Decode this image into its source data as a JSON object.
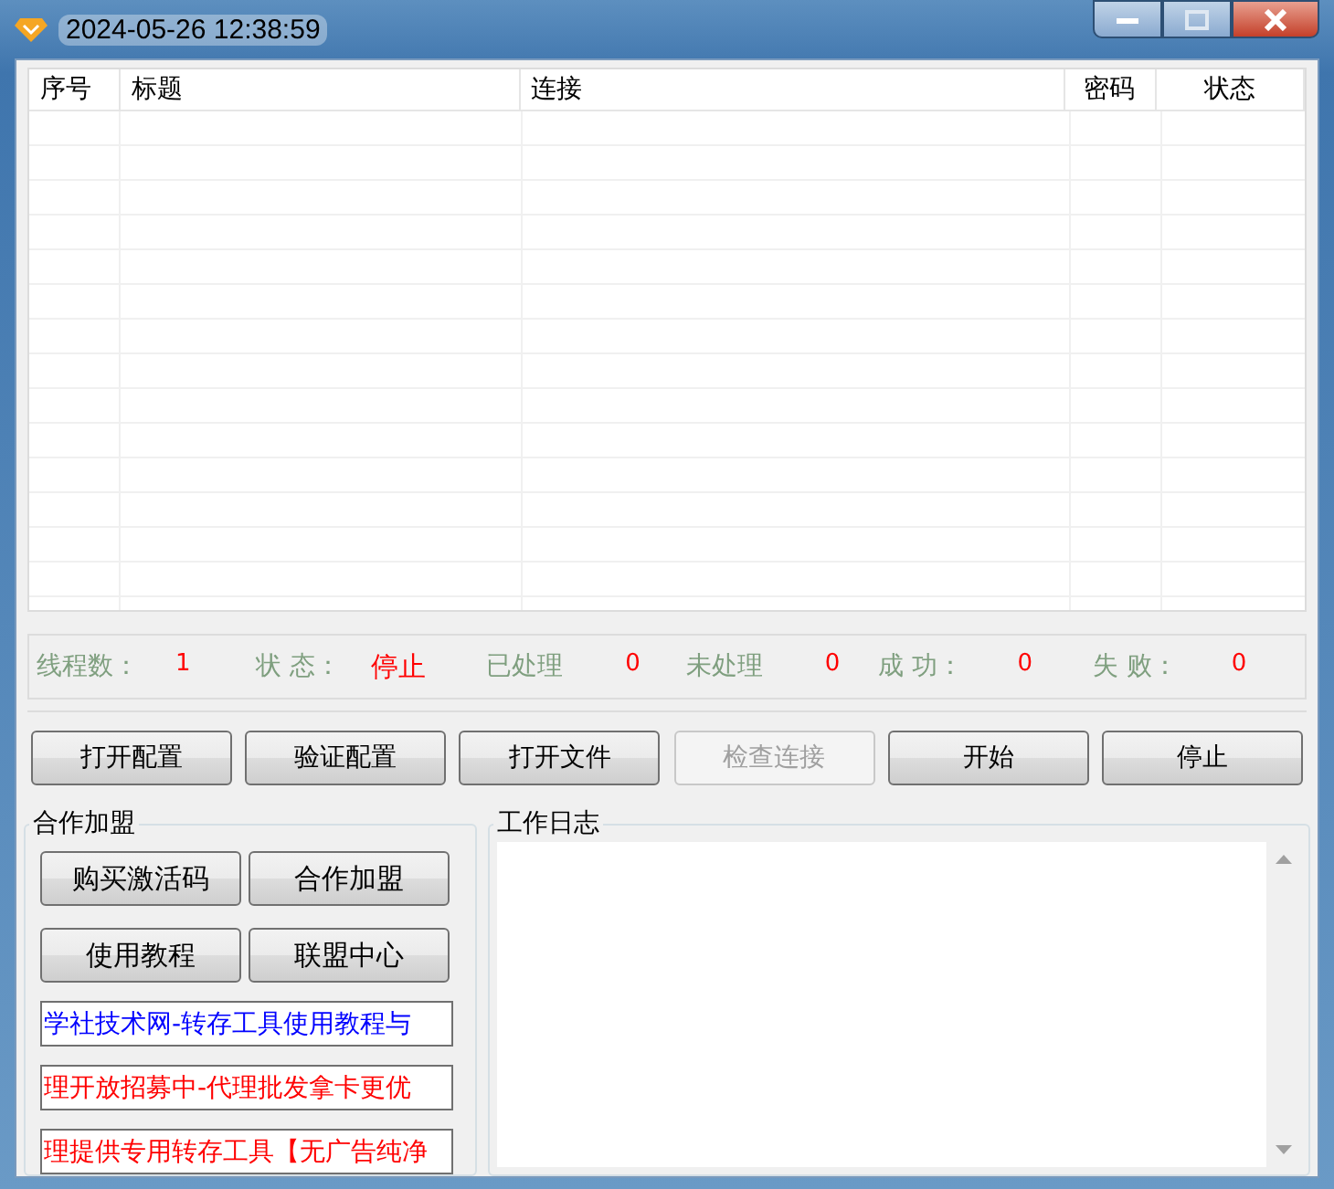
{
  "window": {
    "title": "2024-05-26 12:38:59"
  },
  "table": {
    "columns": [
      "序号",
      "标题",
      "连接",
      "密码",
      "状态"
    ]
  },
  "stats": [
    {
      "label": "线程数：",
      "value": "1"
    },
    {
      "label": "状 态：",
      "value": "停止"
    },
    {
      "label": "已处理",
      "value": "0"
    },
    {
      "label": "未处理",
      "value": "0"
    },
    {
      "label": "成 功：",
      "value": "0"
    },
    {
      "label": "失 败：",
      "value": "0"
    }
  ],
  "buttons": [
    {
      "label": "打开配置",
      "disabled": false
    },
    {
      "label": "验证配置",
      "disabled": false
    },
    {
      "label": "打开文件",
      "disabled": false
    },
    {
      "label": "检查连接",
      "disabled": true
    },
    {
      "label": "开始",
      "disabled": false
    },
    {
      "label": "停止",
      "disabled": false
    }
  ],
  "partner": {
    "title": "合作加盟",
    "buttons": [
      "购买激活码",
      "合作加盟",
      "使用教程",
      "联盟中心"
    ],
    "links": [
      {
        "text": "学社技术网-转存工具使用教程与",
        "color": "#0000ff"
      },
      {
        "text": "理开放招募中-代理批发拿卡更优",
        "color": "#ff0000"
      },
      {
        "text": "理提供专用转存工具【无广告纯净",
        "color": "#ff0000"
      }
    ]
  },
  "log": {
    "title": "工作日志"
  }
}
